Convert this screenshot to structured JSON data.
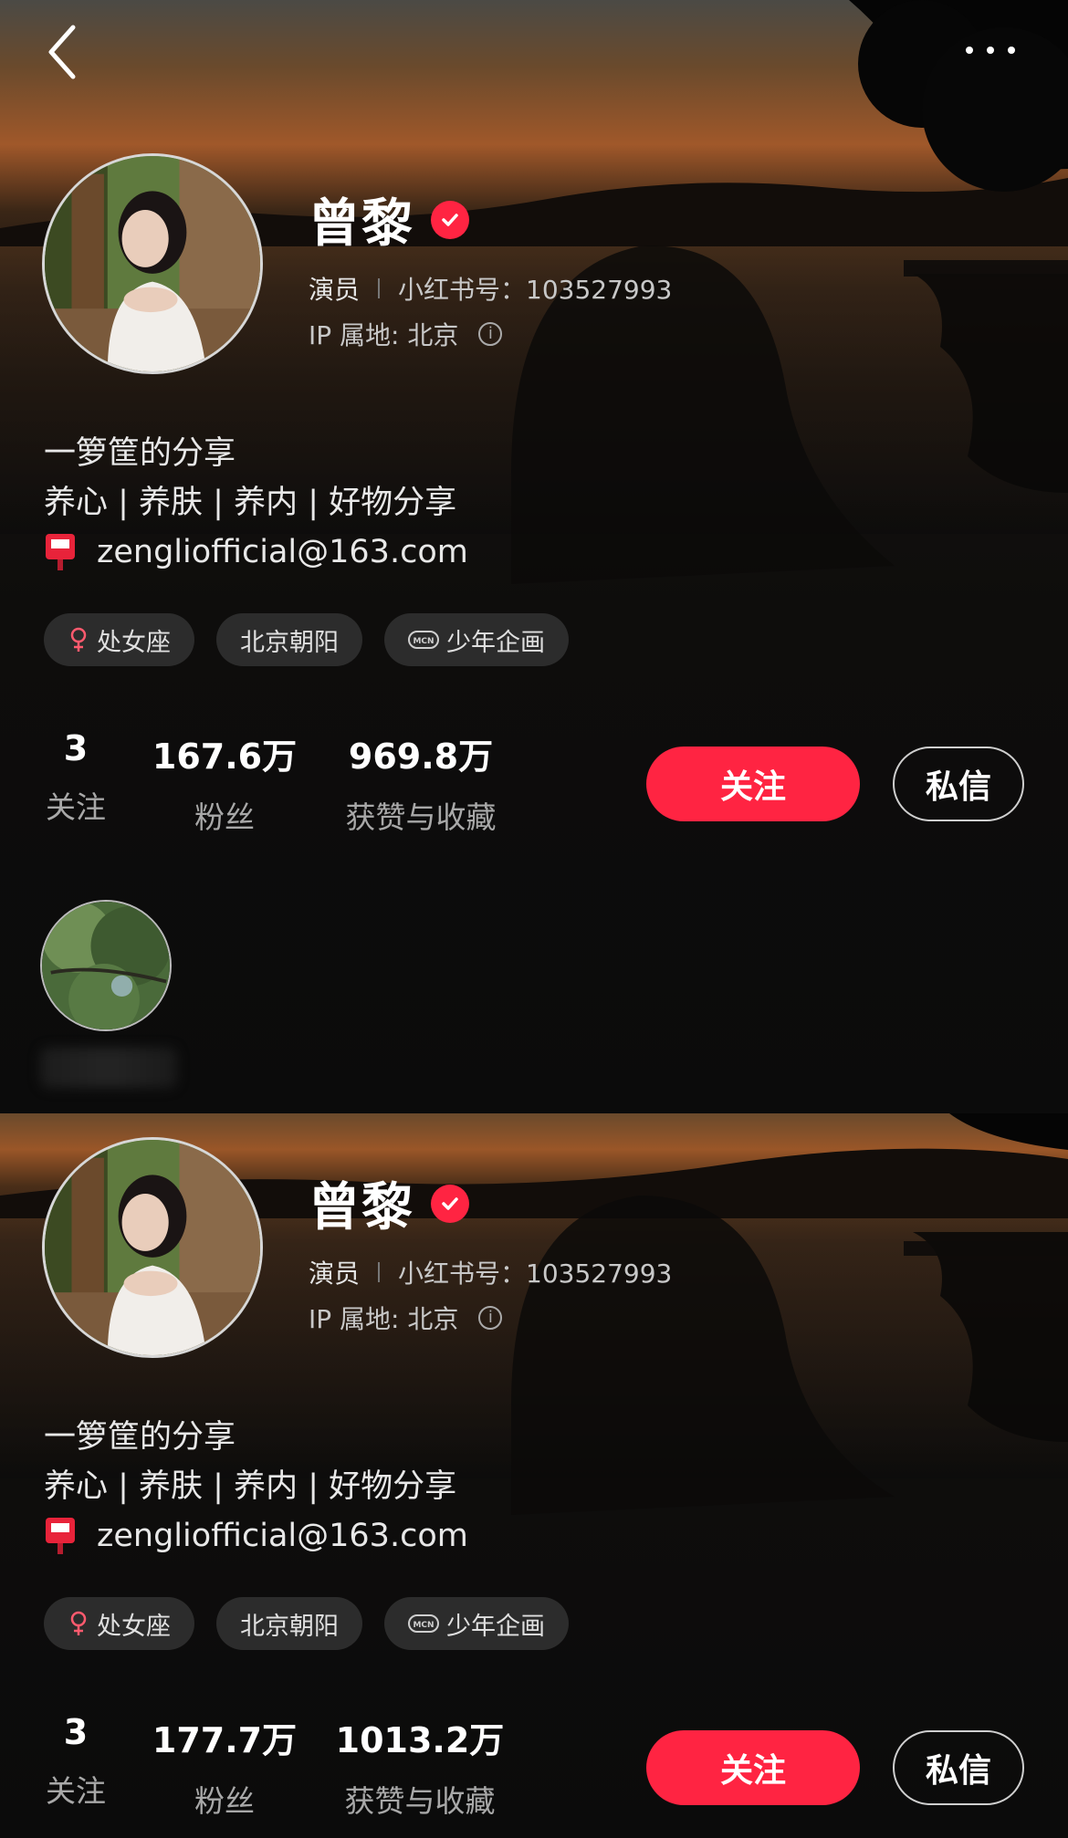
{
  "nav": {
    "back_icon": "chevron-left-icon",
    "more_icon": "more-horizontal-icon"
  },
  "profile_top": {
    "name": "曾黎",
    "role": "演员",
    "id_label": "小红书号：103527993",
    "ip_label": "IP 属地: 北京",
    "info_icon": "i",
    "bio_line1": "一箩筐的分享",
    "bio_line2": "养心 | 养肤 | 养内 | 好物分享",
    "email": "zengliofficial@163.com",
    "tags": {
      "zodiac": "处女座",
      "location": "北京朝阳",
      "mcn": "少年企画",
      "mcn_badge": "MCN"
    },
    "stats": {
      "following_num": "3",
      "following_label": "关注",
      "fans_num": "167.6万",
      "fans_label": "粉丝",
      "likes_num": "969.8万",
      "likes_label": "获赞与收藏"
    },
    "follow_label": "关注",
    "message_label": "私信"
  },
  "profile_bottom": {
    "name": "曾黎",
    "role": "演员",
    "id_label": "小红书号：103527993",
    "ip_label": "IP 属地: 北京",
    "info_icon": "i",
    "bio_line1": "一箩筐的分享",
    "bio_line2": "养心 | 养肤 | 养内 | 好物分享",
    "email": "zengliofficial@163.com",
    "tags": {
      "zodiac": "处女座",
      "location": "北京朝阳",
      "mcn": "少年企画",
      "mcn_badge": "MCN"
    },
    "stats": {
      "following_num": "3",
      "following_label": "关注",
      "fans_num": "177.7万",
      "fans_label": "粉丝",
      "likes_num": "1013.2万",
      "likes_label": "获赞与收藏"
    },
    "follow_label": "关注",
    "message_label": "私信"
  },
  "colors": {
    "accent": "#ff2442",
    "background": "#0b0b0b",
    "tag_bg": "#2c2c2c"
  }
}
